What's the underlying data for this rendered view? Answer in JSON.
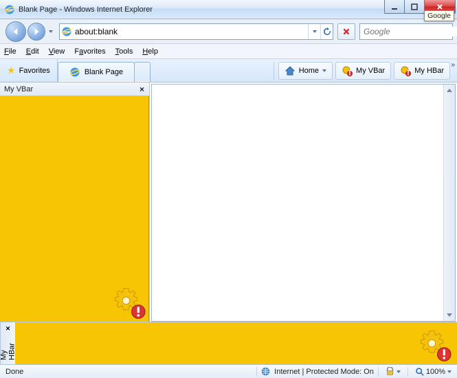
{
  "window": {
    "title": "Blank Page - Windows Internet Explorer",
    "google_chip": "Google"
  },
  "nav": {
    "address_value": "about:blank",
    "search_placeholder": "Google"
  },
  "menus": {
    "file": "File",
    "file_u": "F",
    "edit": "Edit",
    "edit_u": "E",
    "view": "View",
    "view_u": "V",
    "favorites": "Favorites",
    "favorites_u": "a",
    "tools": "Tools",
    "tools_u": "T",
    "help": "Help",
    "help_u": "H"
  },
  "cmd": {
    "favorites_label": "Favorites",
    "tab_label": "Blank Page",
    "home_label": "Home",
    "vbar_label": "My VBar",
    "hbar_label": "My HBar"
  },
  "panes": {
    "vbar_title": "My VBar",
    "hbar_title": "My HBar",
    "close": "×"
  },
  "status": {
    "left": "Done",
    "mode": "Internet | Protected Mode: On",
    "zoom": "100%"
  }
}
